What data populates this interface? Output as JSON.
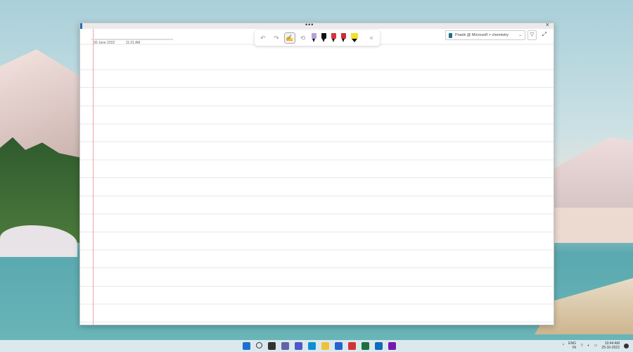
{
  "page": {
    "date": "30 June 2022",
    "time": "11:31 AM"
  },
  "toolbar": {
    "undo": "↶",
    "redo": "↷",
    "ink_to_text": "✍",
    "lasso": "⟲",
    "close": "×"
  },
  "pens": [
    {
      "color": "#b7a2d6"
    },
    {
      "color": "#111111"
    },
    {
      "color": "#d8343f"
    },
    {
      "color": "#c72f3a"
    },
    {
      "color": "#f2e02a"
    }
  ],
  "notebook": {
    "label": "Prasik @ Microsoft > chemistry",
    "chevron": "⌄"
  },
  "window": {
    "dots": "•••",
    "close": "×"
  },
  "taskbar": {
    "apps": [
      {
        "name": "start",
        "color": "#1f6fd1"
      },
      {
        "name": "search",
        "color": "#333333"
      },
      {
        "name": "task-view",
        "color": "#333333"
      },
      {
        "name": "chat",
        "color": "#6264a7"
      },
      {
        "name": "teams",
        "color": "#5059c9"
      },
      {
        "name": "edge",
        "color": "#0f8fd1"
      },
      {
        "name": "file-explorer",
        "color": "#f2c13c"
      },
      {
        "name": "todo",
        "color": "#2564cf"
      },
      {
        "name": "app-red",
        "color": "#d13438"
      },
      {
        "name": "excel",
        "color": "#1d6f42"
      },
      {
        "name": "outlook",
        "color": "#0f6cbd"
      },
      {
        "name": "onenote",
        "color": "#7719aa"
      }
    ],
    "language": "ENG",
    "region": "IN",
    "clock_time": "10:44 AM",
    "clock_date": "25-10-2022",
    "chevron": "^"
  }
}
